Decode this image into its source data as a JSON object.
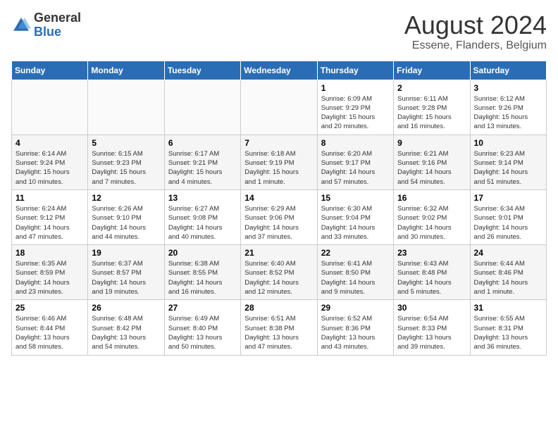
{
  "header": {
    "logo_general": "General",
    "logo_blue": "Blue",
    "month_year": "August 2024",
    "location": "Essene, Flanders, Belgium"
  },
  "days_of_week": [
    "Sunday",
    "Monday",
    "Tuesday",
    "Wednesday",
    "Thursday",
    "Friday",
    "Saturday"
  ],
  "weeks": [
    [
      {
        "num": "",
        "info": ""
      },
      {
        "num": "",
        "info": ""
      },
      {
        "num": "",
        "info": ""
      },
      {
        "num": "",
        "info": ""
      },
      {
        "num": "1",
        "info": "Sunrise: 6:09 AM\nSunset: 9:29 PM\nDaylight: 15 hours\nand 20 minutes."
      },
      {
        "num": "2",
        "info": "Sunrise: 6:11 AM\nSunset: 9:28 PM\nDaylight: 15 hours\nand 16 minutes."
      },
      {
        "num": "3",
        "info": "Sunrise: 6:12 AM\nSunset: 9:26 PM\nDaylight: 15 hours\nand 13 minutes."
      }
    ],
    [
      {
        "num": "4",
        "info": "Sunrise: 6:14 AM\nSunset: 9:24 PM\nDaylight: 15 hours\nand 10 minutes."
      },
      {
        "num": "5",
        "info": "Sunrise: 6:15 AM\nSunset: 9:23 PM\nDaylight: 15 hours\nand 7 minutes."
      },
      {
        "num": "6",
        "info": "Sunrise: 6:17 AM\nSunset: 9:21 PM\nDaylight: 15 hours\nand 4 minutes."
      },
      {
        "num": "7",
        "info": "Sunrise: 6:18 AM\nSunset: 9:19 PM\nDaylight: 15 hours\nand 1 minute."
      },
      {
        "num": "8",
        "info": "Sunrise: 6:20 AM\nSunset: 9:17 PM\nDaylight: 14 hours\nand 57 minutes."
      },
      {
        "num": "9",
        "info": "Sunrise: 6:21 AM\nSunset: 9:16 PM\nDaylight: 14 hours\nand 54 minutes."
      },
      {
        "num": "10",
        "info": "Sunrise: 6:23 AM\nSunset: 9:14 PM\nDaylight: 14 hours\nand 51 minutes."
      }
    ],
    [
      {
        "num": "11",
        "info": "Sunrise: 6:24 AM\nSunset: 9:12 PM\nDaylight: 14 hours\nand 47 minutes."
      },
      {
        "num": "12",
        "info": "Sunrise: 6:26 AM\nSunset: 9:10 PM\nDaylight: 14 hours\nand 44 minutes."
      },
      {
        "num": "13",
        "info": "Sunrise: 6:27 AM\nSunset: 9:08 PM\nDaylight: 14 hours\nand 40 minutes."
      },
      {
        "num": "14",
        "info": "Sunrise: 6:29 AM\nSunset: 9:06 PM\nDaylight: 14 hours\nand 37 minutes."
      },
      {
        "num": "15",
        "info": "Sunrise: 6:30 AM\nSunset: 9:04 PM\nDaylight: 14 hours\nand 33 minutes."
      },
      {
        "num": "16",
        "info": "Sunrise: 6:32 AM\nSunset: 9:02 PM\nDaylight: 14 hours\nand 30 minutes."
      },
      {
        "num": "17",
        "info": "Sunrise: 6:34 AM\nSunset: 9:01 PM\nDaylight: 14 hours\nand 26 minutes."
      }
    ],
    [
      {
        "num": "18",
        "info": "Sunrise: 6:35 AM\nSunset: 8:59 PM\nDaylight: 14 hours\nand 23 minutes."
      },
      {
        "num": "19",
        "info": "Sunrise: 6:37 AM\nSunset: 8:57 PM\nDaylight: 14 hours\nand 19 minutes."
      },
      {
        "num": "20",
        "info": "Sunrise: 6:38 AM\nSunset: 8:55 PM\nDaylight: 14 hours\nand 16 minutes."
      },
      {
        "num": "21",
        "info": "Sunrise: 6:40 AM\nSunset: 8:52 PM\nDaylight: 14 hours\nand 12 minutes."
      },
      {
        "num": "22",
        "info": "Sunrise: 6:41 AM\nSunset: 8:50 PM\nDaylight: 14 hours\nand 9 minutes."
      },
      {
        "num": "23",
        "info": "Sunrise: 6:43 AM\nSunset: 8:48 PM\nDaylight: 14 hours\nand 5 minutes."
      },
      {
        "num": "24",
        "info": "Sunrise: 6:44 AM\nSunset: 8:46 PM\nDaylight: 14 hours\nand 1 minute."
      }
    ],
    [
      {
        "num": "25",
        "info": "Sunrise: 6:46 AM\nSunset: 8:44 PM\nDaylight: 13 hours\nand 58 minutes."
      },
      {
        "num": "26",
        "info": "Sunrise: 6:48 AM\nSunset: 8:42 PM\nDaylight: 13 hours\nand 54 minutes."
      },
      {
        "num": "27",
        "info": "Sunrise: 6:49 AM\nSunset: 8:40 PM\nDaylight: 13 hours\nand 50 minutes."
      },
      {
        "num": "28",
        "info": "Sunrise: 6:51 AM\nSunset: 8:38 PM\nDaylight: 13 hours\nand 47 minutes."
      },
      {
        "num": "29",
        "info": "Sunrise: 6:52 AM\nSunset: 8:36 PM\nDaylight: 13 hours\nand 43 minutes."
      },
      {
        "num": "30",
        "info": "Sunrise: 6:54 AM\nSunset: 8:33 PM\nDaylight: 13 hours\nand 39 minutes."
      },
      {
        "num": "31",
        "info": "Sunrise: 6:55 AM\nSunset: 8:31 PM\nDaylight: 13 hours\nand 36 minutes."
      }
    ]
  ]
}
